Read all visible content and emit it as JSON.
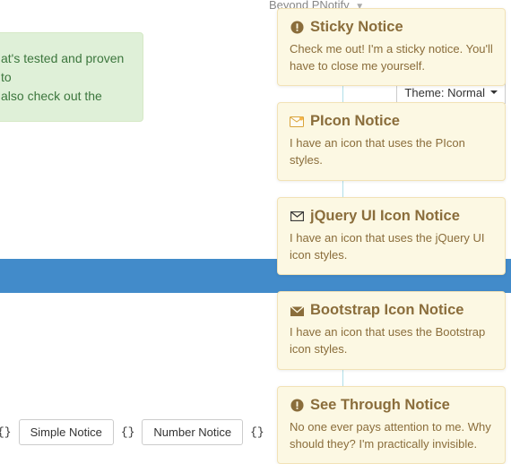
{
  "breadcrumb": {
    "label": "Beyond PNotify"
  },
  "green_box": {
    "line1": "at's tested and proven to",
    "line2": "also check out the"
  },
  "theme_select": {
    "label": "Theme: Normal"
  },
  "buttons": {
    "b1": "Simple Notice",
    "b2": "Number Notice"
  },
  "braces": {
    "b": "{}"
  },
  "notices": [
    {
      "icon": "exclaim",
      "title": "Sticky Notice",
      "text": "Check me out! I'm a sticky notice. You'll have to close me yourself."
    },
    {
      "icon": "picon",
      "title": "PIcon Notice",
      "text": "I have an icon that uses the PIcon styles."
    },
    {
      "icon": "jqui",
      "title": "jQuery UI Icon Notice",
      "text": "I have an icon that uses the jQuery UI icon styles."
    },
    {
      "icon": "envelope",
      "title": "Bootstrap Icon Notice",
      "text": "I have an icon that uses the Bootstrap icon styles."
    },
    {
      "icon": "exclaim",
      "title": "See Through Notice",
      "text": "No one ever pays attention to me. Why should they? I'm practically invisible."
    }
  ]
}
